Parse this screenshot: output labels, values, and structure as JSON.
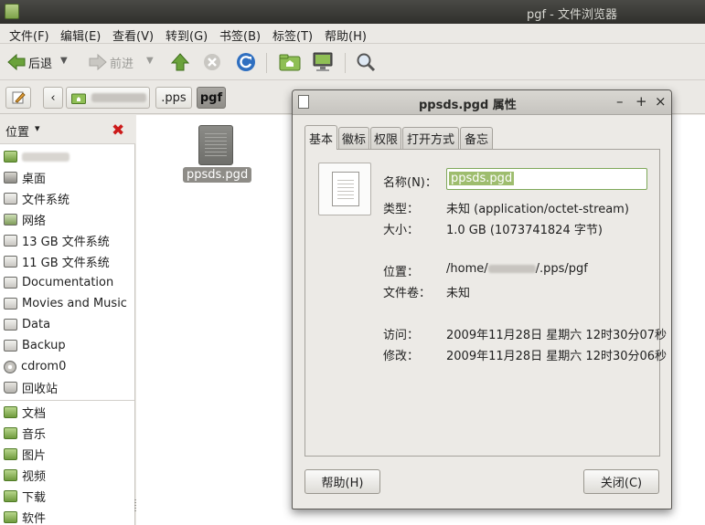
{
  "window": {
    "title": "pgf - 文件浏览器"
  },
  "menubar": [
    "文件(F)",
    "编辑(E)",
    "查看(V)",
    "转到(G)",
    "书签(B)",
    "标签(T)",
    "帮助(H)"
  ],
  "toolbar": {
    "back": "后退",
    "forward": "前进"
  },
  "location": {
    "crumbs": [
      ".pps",
      "pgf"
    ]
  },
  "sidebar": {
    "header": "位置",
    "items": [
      "桌面",
      "文件系统",
      "网络",
      "13 GB 文件系统",
      "11 GB 文件系统",
      "Documentation",
      "Movies and Music",
      "Data",
      "Backup",
      "cdrom0",
      "回收站"
    ],
    "bookmarks": [
      "文档",
      "音乐",
      "图片",
      "视频",
      "下载",
      "软件"
    ]
  },
  "files": [
    {
      "name": "ppsds.pgd"
    }
  ],
  "dialog": {
    "title": "ppsds.pgd 属性",
    "tabs": [
      "基本",
      "徽标",
      "权限",
      "打开方式",
      "备忘"
    ],
    "name_label": "名称(N)：",
    "name_value": "ppsds.pgd",
    "type_label": "类型：",
    "type_value": "未知 (application/octet-stream)",
    "size_label": "大小：",
    "size_value": "1.0 GB (1073741824 字节)",
    "location_label": "位置：",
    "location_prefix": "/home/",
    "location_suffix": "/.pps/pgf",
    "volume_label": "文件卷：",
    "volume_value": "未知",
    "accessed_label": "访问：",
    "accessed_value": "2009年11月28日 星期六 12时30分07秒",
    "modified_label": "修改：",
    "modified_value": "2009年11月28日 星期六 12时30分06秒",
    "help_button": "帮助(H)",
    "close_button": "关闭(C)"
  }
}
